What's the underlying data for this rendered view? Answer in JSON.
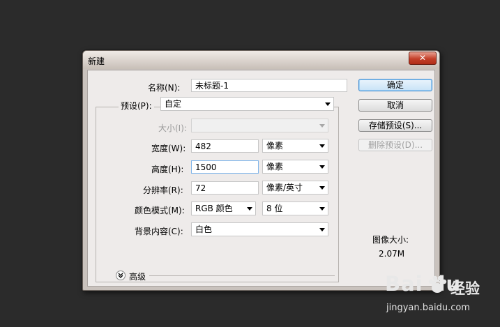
{
  "dialog": {
    "title": "新建",
    "close_glyph": "✕",
    "name": {
      "label": "名称(N):",
      "value": "未标题-1"
    },
    "preset": {
      "label": "预设(P):",
      "value": "自定"
    },
    "size": {
      "label": "大小(I):",
      "value": ""
    },
    "width": {
      "label": "宽度(W):",
      "value": "482",
      "unit": "像素"
    },
    "height": {
      "label": "高度(H):",
      "value": "1500",
      "unit": "像素"
    },
    "resolution": {
      "label": "分辨率(R):",
      "value": "72",
      "unit": "像素/英寸"
    },
    "color_mode": {
      "label": "颜色模式(M):",
      "value": "RGB 颜色",
      "depth": "8 位"
    },
    "background": {
      "label": "背景内容(C):",
      "value": "白色"
    },
    "advanced": {
      "label": "高级",
      "icon": "chevron-double-down-icon"
    },
    "buttons": {
      "ok": "确定",
      "cancel": "取消",
      "save_preset": "存储预设(S)...",
      "delete_preset": "删除预设(D)..."
    },
    "image_size": {
      "label": "图像大小:",
      "value": "2.07M"
    }
  },
  "watermark": {
    "brand": "Bai du",
    "cn": "经验",
    "url": "jingyan.baidu.com"
  },
  "colors": {
    "background": "#2b2b2b",
    "dialog_frame": "#c9c2bd",
    "panel": "#eeebea",
    "close_button": "#c4402a",
    "focus_border": "#7eb4ea"
  }
}
